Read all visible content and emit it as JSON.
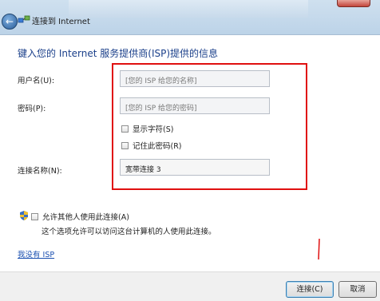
{
  "window": {
    "title": "连接到 Internet"
  },
  "heading": "键入您的 Internet 服务提供商(ISP)提供的信息",
  "form": {
    "username": {
      "label": "用户名(U):",
      "placeholder": "[您的 ISP 给您的名称]"
    },
    "password": {
      "label": "密码(P):",
      "placeholder": "[您的 ISP 给您的密码]"
    },
    "show_chars": "显示字符(S)",
    "remember": "记住此密码(R)",
    "conn_name": {
      "label": "连接名称(N):",
      "value": "宽带连接 3"
    }
  },
  "allow": {
    "label": "允许其他人使用此连接(A)",
    "desc": "这个选项允许可以访问这台计算机的人使用此连接。"
  },
  "no_isp_link": "我没有 ISP",
  "buttons": {
    "connect": "连接(C)",
    "cancel": "取消"
  },
  "colors": {
    "highlight_border": "#e01010",
    "heading": "#1a3f8a",
    "link": "#1a4fb0"
  },
  "icons": {
    "back": "back-arrow-icon",
    "network": "network-icon",
    "shield": "uac-shield-icon"
  }
}
